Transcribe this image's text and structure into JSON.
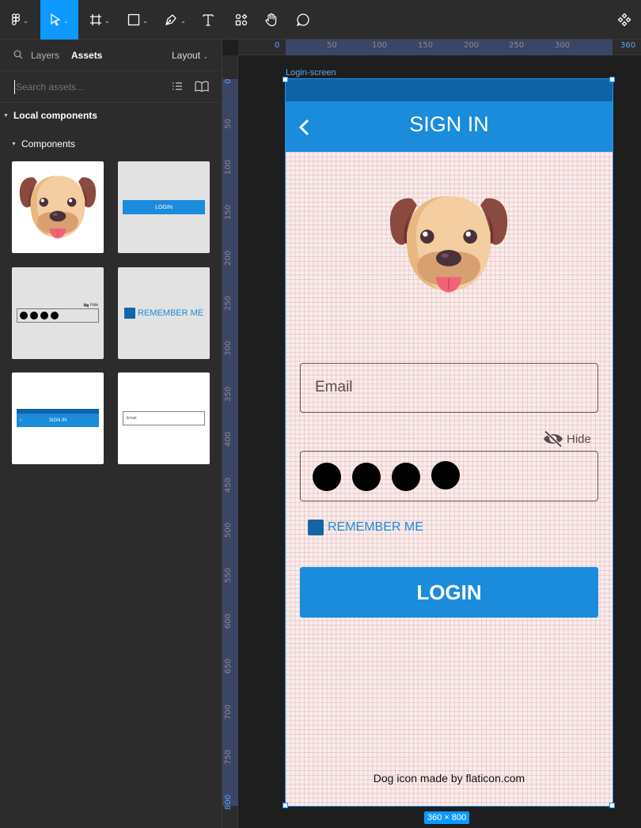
{
  "toolbar": {
    "tools": [
      "main-menu",
      "move",
      "frame",
      "shape",
      "pen",
      "text",
      "resources",
      "hand",
      "comment",
      "components"
    ]
  },
  "sidebar": {
    "tab_layers": "Layers",
    "tab_assets": "Assets",
    "layout_label": "Layout",
    "search_placeholder": "Search assets...",
    "local_components": "Local components",
    "components": "Components",
    "thumbs": {
      "login_label": "LOGIN",
      "hide_label": "Hide",
      "remember_label": "REMEMBER ME",
      "signin_label": "SIGN IN",
      "email_label": "Email"
    }
  },
  "rulers": {
    "top": [
      "0",
      "50",
      "100",
      "150",
      "200",
      "250",
      "300",
      "360"
    ],
    "left": [
      "0",
      "50",
      "100",
      "150",
      "200",
      "250",
      "300",
      "350",
      "400",
      "450",
      "500",
      "550",
      "600",
      "650",
      "700",
      "750",
      "800"
    ]
  },
  "frame": {
    "name": "Login-screen",
    "size_badge": "360 × 800",
    "header_title": "SIGN IN",
    "email_placeholder": "Email",
    "hide_label": "Hide",
    "password_dot_count": 4,
    "remember_label": "REMEMBER ME",
    "login_button": "LOGIN",
    "footer": "Dog icon made by flaticon.com"
  },
  "colors": {
    "accent": "#0d99ff",
    "app_blue": "#1a8cdb",
    "status_bar": "#0e63a8",
    "checkbox": "#1565a6",
    "frame_bg": "#f8eded"
  }
}
